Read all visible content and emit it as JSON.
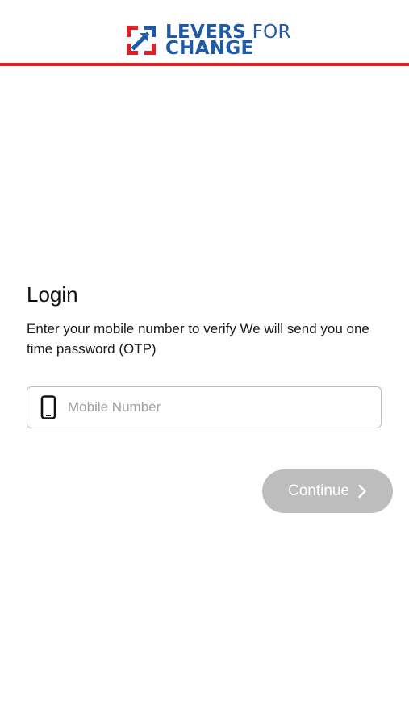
{
  "header": {
    "logo_line1_bold": "LEVERS",
    "logo_line1_light": " FOR",
    "logo_line2": "CHANGE",
    "brand_blue": "#1f5aa6",
    "brand_red": "#e01e25"
  },
  "login": {
    "title": "Login",
    "subtitle": "Enter your mobile number to verify We will send you one time password (OTP)"
  },
  "mobile_field": {
    "icon": "smartphone-icon",
    "placeholder": "Mobile Number",
    "value": ""
  },
  "continue_button": {
    "label": "Continue",
    "icon": "chevron-right-icon",
    "background": "#bdbdbd"
  }
}
